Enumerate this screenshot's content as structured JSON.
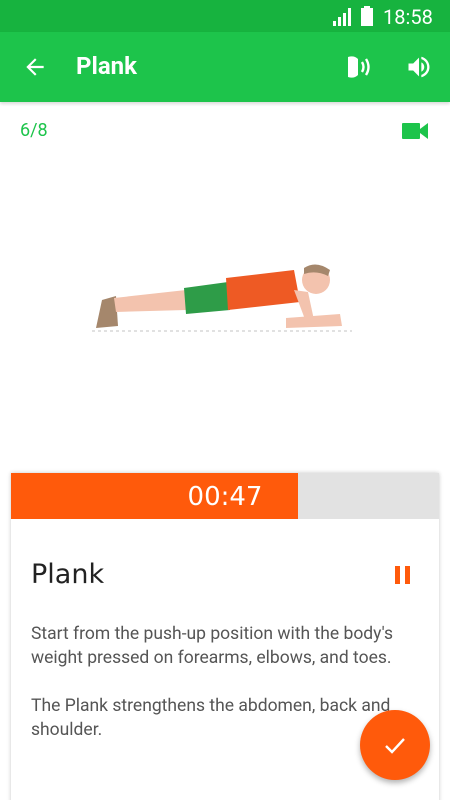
{
  "status_bar": {
    "time": "18:58"
  },
  "app_bar": {
    "title": "Plank"
  },
  "progress": {
    "label": "6/8"
  },
  "timer": {
    "text": "00:47",
    "fraction": 0.67
  },
  "exercise": {
    "title": "Plank",
    "description": [
      "Start from the push-up position with the body's weight pressed on forearms, elbows, and toes.",
      "The Plank strengthens the abdomen, back and shoulder."
    ]
  },
  "colors": {
    "status_bar": "#17b33f",
    "app_bar": "#1dc44b",
    "accent": "#ff5a0b",
    "track": "#e2e2e2"
  },
  "icons": {
    "back": "arrow-left-icon",
    "voice": "voice-coach-icon",
    "volume": "volume-icon",
    "video": "video-camera-icon",
    "pause": "pause-icon",
    "done": "check-icon"
  }
}
